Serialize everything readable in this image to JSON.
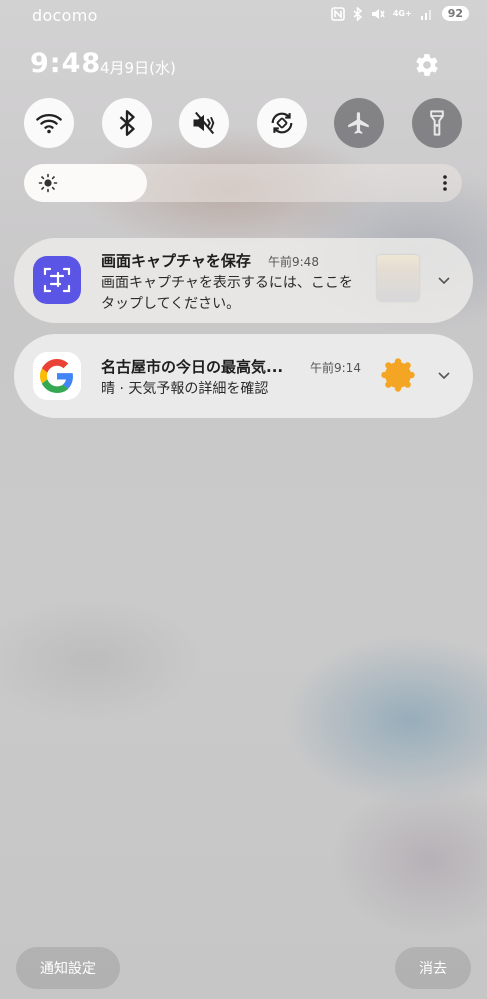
{
  "status_bar": {
    "carrier": "docomo",
    "network_type": "4G+",
    "battery": "92"
  },
  "header": {
    "time": "9:48",
    "date": "4月9日(水)"
  },
  "quick_settings": {
    "tiles": [
      {
        "name": "wifi",
        "icon": "wifi-icon",
        "active": true
      },
      {
        "name": "bluetooth",
        "icon": "bluetooth-icon",
        "active": true
      },
      {
        "name": "sound",
        "icon": "mute-icon",
        "active": true
      },
      {
        "name": "auto-rotate",
        "icon": "rotate-icon",
        "active": true
      },
      {
        "name": "airplane",
        "icon": "airplane-icon",
        "active": false
      },
      {
        "name": "flashlight",
        "icon": "flashlight-icon",
        "active": false
      }
    ],
    "brightness_level": 0.28
  },
  "notifications": [
    {
      "app_icon": "screen-capture-icon",
      "title": "画面キャプチャを保存",
      "time": "午前9:48",
      "body": "画面キャプチャを表示するには、ここをタップしてください。"
    },
    {
      "app_icon": "google-icon",
      "title": "名古屋市の今日の最高気...",
      "time": "午前9:14",
      "body": "晴 · 天気予報の詳細を確認"
    }
  ],
  "footer": {
    "settings_label": "通知設定",
    "clear_label": "消去"
  },
  "colors": {
    "capture_app": "#5b55e6",
    "weather_sun": "#f4a524"
  }
}
